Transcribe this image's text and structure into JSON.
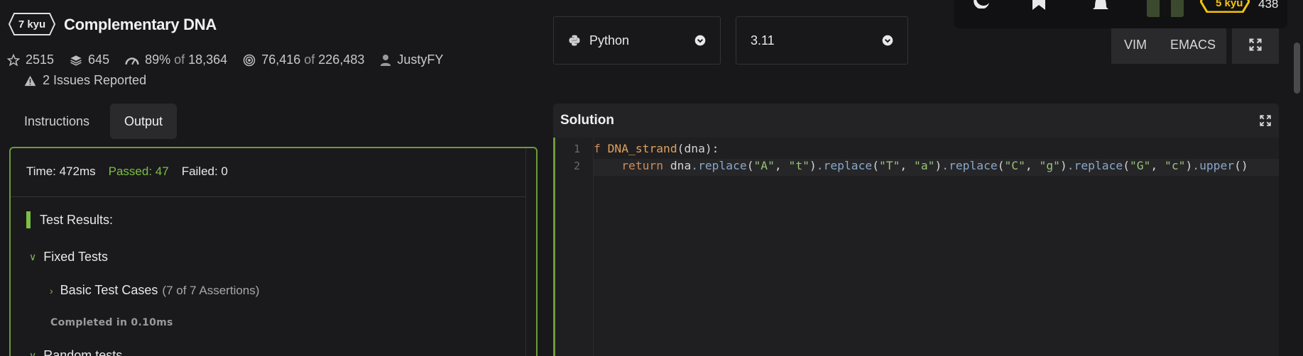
{
  "kata": {
    "rank": "7 kyu",
    "title": "Complementary DNA",
    "stars": "2515",
    "collections": "645",
    "satisfaction": "89%",
    "satisfaction_of": "of",
    "satisfaction_total": "18,364",
    "completions": "76,416",
    "completions_of": "of",
    "completions_total": "226,483",
    "author": "JustyFY",
    "issues": "2 Issues Reported"
  },
  "tabs": [
    {
      "label": "Instructions",
      "active": false
    },
    {
      "label": "Output",
      "active": true
    }
  ],
  "output": {
    "time": "Time: 472ms",
    "passed": "Passed: 47",
    "failed": "Failed: 0",
    "results_title": "Test Results:",
    "fixed_tests": "Fixed Tests",
    "basic_tests": "Basic Test Cases",
    "basic_tests_assertions": "(7 of 7 Assertions)",
    "completed": "Completed in 0.10ms",
    "random_tests": "Random tests"
  },
  "language_select": {
    "value": "Python",
    "icon": "python-icon"
  },
  "version_select": {
    "value": "3.11"
  },
  "editor_modes": {
    "vim": "VIM",
    "emacs": "EMACS"
  },
  "topnav": {
    "user_rank": "5 kyu",
    "honor": "438"
  },
  "solution": {
    "title": "Solution",
    "line_numbers": [
      "1",
      "2"
    ],
    "line1": {
      "kw": "f",
      "fn": "DNA_strand",
      "rest": "(dna):"
    },
    "line2": {
      "indent": "    ",
      "kw": "return",
      "obj": " dna",
      "r1": ".replace",
      "a1": "\"A\"",
      "b1": "\"t\"",
      "r2": ".replace",
      "a2": "\"T\"",
      "b2": "\"a\"",
      "r3": ".replace",
      "a3": "\"C\"",
      "b3": "\"g\"",
      "r4": ".replace",
      "a4": "\"G\"",
      "b4": "\"c\"",
      "up": ".upper",
      "open": "(",
      "comma": ", ",
      "close": ")",
      "call": "()"
    }
  },
  "colors": {
    "accent_green": "#7cbf45",
    "border_green": "#6c9a3c",
    "rank_yellow": "#f1c40f",
    "background": "#18181a"
  }
}
